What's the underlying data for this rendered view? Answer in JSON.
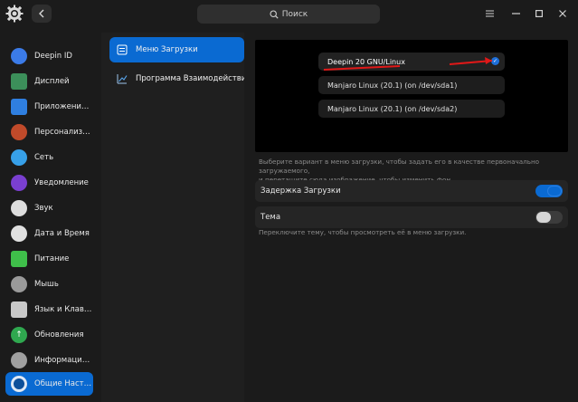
{
  "titlebar": {
    "search_placeholder": "Поиск"
  },
  "sidebar": {
    "items": [
      {
        "label": "Deepin ID",
        "icon": "cloud-icon",
        "color": "#3b7be8"
      },
      {
        "label": "Дисплей",
        "icon": "display-icon",
        "color": "#3c8f5a"
      },
      {
        "label": "Приложения п...",
        "icon": "default-apps-icon",
        "color": "#2f7fe0"
      },
      {
        "label": "Персонализац...",
        "icon": "personalization-icon",
        "color": "#c04a2a"
      },
      {
        "label": "Сеть",
        "icon": "network-icon",
        "color": "#37a0e8"
      },
      {
        "label": "Уведомление",
        "icon": "notification-icon",
        "color": "#7a3fd0"
      },
      {
        "label": "Звук",
        "icon": "sound-icon",
        "color": "#dddddd"
      },
      {
        "label": "Дата и Время",
        "icon": "clock-icon",
        "color": "#e0e0e0"
      },
      {
        "label": "Питание",
        "icon": "power-icon",
        "color": "#3fbf4a"
      },
      {
        "label": "Мышь",
        "icon": "mouse-icon",
        "color": "#9a9a9a"
      },
      {
        "label": "Язык и Клавиа...",
        "icon": "keyboard-icon",
        "color": "#c8c8c8"
      },
      {
        "label": "Обновления",
        "icon": "update-icon",
        "color": "#2fa84f"
      },
      {
        "label": "Информация о...",
        "icon": "info-icon",
        "color": "#a0a0a0"
      },
      {
        "label": "Общие Настро...",
        "icon": "general-settings-icon",
        "color": "#0a6ad2",
        "active": true
      }
    ]
  },
  "midpanel": {
    "items": [
      {
        "label": "Меню Загрузки",
        "icon": "boot-menu-icon",
        "active": true
      },
      {
        "label": "Программа Взаимодействия с П",
        "icon": "chart-icon",
        "active": false
      }
    ]
  },
  "preview": {
    "entries": [
      {
        "label": "Deepin 20 GNU/Linux",
        "selected": true
      },
      {
        "label": "Manjaro Linux (20.1) (on /dev/sda1)",
        "selected": false
      },
      {
        "label": "Manjaro Linux (20.1) (on /dev/sda2)",
        "selected": false
      }
    ],
    "annotation_color": "#e01818"
  },
  "content": {
    "hint_line1": "Выберите вариант в меню загрузки, чтобы задать его в качестве первоначально загружаемого,",
    "hint_line2": "и перетащите сюда изображение, чтобы изменить фон",
    "boot_delay_label": "Задержка Загрузки",
    "boot_delay_on": true,
    "theme_label": "Тема",
    "theme_on": false,
    "theme_hint": "Переключите тему, чтобы просмотреть её в меню загрузки."
  },
  "colors": {
    "accent": "#0a6ad2",
    "background": "#1b1b1b"
  }
}
